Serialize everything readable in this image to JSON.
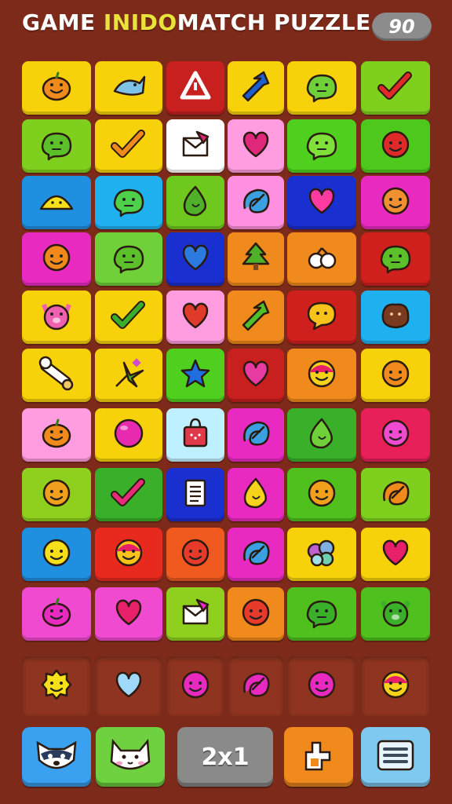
{
  "header": {
    "title_part1": "GAME ",
    "title_accent": "INIDO",
    "title_part2": "MATCH PUZZLE",
    "score": "90"
  },
  "board": {
    "rows": [
      [
        {
          "color": "#f7d20a",
          "icon": "pumpkin-icon",
          "fg": "#f08a1c"
        },
        {
          "color": "#f7d20a",
          "icon": "fish-icon",
          "fg": "#7fc3e8"
        },
        {
          "color": "#c81f1f",
          "icon": "warning-triangle-icon",
          "fg": "#ffffff"
        },
        {
          "color": "#f7d20a",
          "icon": "arrow-icon",
          "fg": "#1e5fd0"
        },
        {
          "color": "#f7d20a",
          "icon": "blob-face-icon",
          "fg": "#6fd03a"
        },
        {
          "color": "#7fd01e",
          "icon": "checkmark-icon",
          "fg": "#e02a2a"
        }
      ],
      [
        {
          "color": "#7fd01e",
          "icon": "blob-face-icon",
          "fg": "#5cc02a"
        },
        {
          "color": "#f7d20a",
          "icon": "checkmark-icon",
          "fg": "#f08a1c"
        },
        {
          "color": "#ffffff",
          "icon": "envelope-icon",
          "fg": "#e0287a"
        },
        {
          "color": "#ff9de0",
          "icon": "heart-icon",
          "fg": "#e0287a"
        },
        {
          "color": "#4fd01e",
          "icon": "blob-face-icon",
          "fg": "#7fe03a"
        },
        {
          "color": "#4fc81e",
          "icon": "round-face-icon",
          "fg": "#e02a2a"
        }
      ],
      [
        {
          "color": "#1f8fe0",
          "icon": "lemon-slice-icon",
          "fg": "#f7e01a"
        },
        {
          "color": "#1fb0f0",
          "icon": "blob-face-icon",
          "fg": "#4fd04a"
        },
        {
          "color": "#6fc81e",
          "icon": "drop-icon",
          "fg": "#4fb02a"
        },
        {
          "color": "#ff8fe0",
          "icon": "swirl-icon",
          "fg": "#3aa0e0"
        },
        {
          "color": "#1a2fd0",
          "icon": "heart-icon",
          "fg": "#ff3aa0"
        },
        {
          "color": "#e82ac0",
          "icon": "round-face-icon",
          "fg": "#f09030"
        }
      ],
      [
        {
          "color": "#e82ac0",
          "icon": "round-face-icon",
          "fg": "#f08a1c"
        },
        {
          "color": "#6fd03a",
          "icon": "blob-face-icon",
          "fg": "#5cc02a"
        },
        {
          "color": "#1a2fd0",
          "icon": "heart-icon",
          "fg": "#2a7ae0"
        },
        {
          "color": "#f08a1c",
          "icon": "tree-icon",
          "fg": "#4fb02a"
        },
        {
          "color": "#f08a1c",
          "icon": "berries-icon",
          "fg": "#ffffff"
        },
        {
          "color": "#d0201e",
          "icon": "blob-face-icon",
          "fg": "#5cc02a"
        }
      ],
      [
        {
          "color": "#f7d20a",
          "icon": "pig-face-icon",
          "fg": "#f060b0"
        },
        {
          "color": "#f7d20a",
          "icon": "checkmark-icon",
          "fg": "#3ab02a"
        },
        {
          "color": "#ff9de0",
          "icon": "heart-icon",
          "fg": "#e03a2a"
        },
        {
          "color": "#f08a1c",
          "icon": "arrow-icon",
          "fg": "#4fc02a"
        },
        {
          "color": "#d0201e",
          "icon": "speech-face-icon",
          "fg": "#f7c21a"
        },
        {
          "color": "#1fb0f0",
          "icon": "cookie-icon",
          "fg": "#7a3a20"
        }
      ],
      [
        {
          "color": "#f7d20a",
          "icon": "bone-icon",
          "fg": "#ffffff"
        },
        {
          "color": "#f7d20a",
          "icon": "star-burst-icon",
          "fg": "#4fb02a"
        },
        {
          "color": "#4fd01e",
          "icon": "star-icon",
          "fg": "#1f6fe0"
        },
        {
          "color": "#c81f1f",
          "icon": "heart-icon",
          "fg": "#e83aa0"
        },
        {
          "color": "#f08a1c",
          "icon": "smile-face-icon",
          "fg": "#f7d21a"
        },
        {
          "color": "#f7d20a",
          "icon": "round-face-icon",
          "fg": "#f08a1c"
        }
      ],
      [
        {
          "color": "#ff9de0",
          "icon": "pumpkin-icon",
          "fg": "#f08a1c"
        },
        {
          "color": "#f7d20a",
          "icon": "ball-icon",
          "fg": "#e82ab0"
        },
        {
          "color": "#bff0ff",
          "icon": "bag-icon",
          "fg": "#e03a4a"
        },
        {
          "color": "#e82ac0",
          "icon": "swirl-icon",
          "fg": "#3aa0e0"
        },
        {
          "color": "#3ab02a",
          "icon": "drop-icon",
          "fg": "#6fd03a"
        },
        {
          "color": "#e8205a",
          "icon": "round-face-icon",
          "fg": "#f04ad0"
        }
      ],
      [
        {
          "color": "#8fd01e",
          "icon": "round-face-icon",
          "fg": "#f0a01c"
        },
        {
          "color": "#3ab02a",
          "icon": "checkmark-icon",
          "fg": "#e82a7a"
        },
        {
          "color": "#1a2fd0",
          "icon": "document-icon",
          "fg": "#ffffff"
        },
        {
          "color": "#e82ac0",
          "icon": "drop-icon",
          "fg": "#f7d21a"
        },
        {
          "color": "#4fc01e",
          "icon": "round-face-icon",
          "fg": "#f0a01c"
        },
        {
          "color": "#7fd01e",
          "icon": "swirl-icon",
          "fg": "#f08a1c"
        }
      ],
      [
        {
          "color": "#1f8fe0",
          "icon": "round-face-icon",
          "fg": "#f7e01a"
        },
        {
          "color": "#e82a1e",
          "icon": "smile-face-icon",
          "fg": "#f7c21a"
        },
        {
          "color": "#f05a1e",
          "icon": "round-face-icon",
          "fg": "#e83a2a"
        },
        {
          "color": "#e82ac0",
          "icon": "swirl-icon",
          "fg": "#3aa0e0"
        },
        {
          "color": "#f7d20a",
          "icon": "cloud-icon",
          "fg": "#7fb0e0"
        },
        {
          "color": "#f7d20a",
          "icon": "heart-icon",
          "fg": "#e8206a"
        }
      ],
      [
        {
          "color": "#f04ad0",
          "icon": "pumpkin-icon",
          "fg": "#e82ac0"
        },
        {
          "color": "#f04ad0",
          "icon": "heart-icon",
          "fg": "#e8206a"
        },
        {
          "color": "#8fd01e",
          "icon": "envelope-icon",
          "fg": "#e82ac0"
        },
        {
          "color": "#f08a1c",
          "icon": "round-face-icon",
          "fg": "#e83a2a"
        },
        {
          "color": "#4fc01e",
          "icon": "blob-face-icon",
          "fg": "#3ab02a"
        },
        {
          "color": "#4fc01e",
          "icon": "pig-face-icon",
          "fg": "#3ab02a"
        }
      ]
    ]
  },
  "tray": {
    "slots": [
      {
        "icon": "spiky-face-icon",
        "fg": "#f7e01a"
      },
      {
        "icon": "heart-icon",
        "fg": "#9fd8f8"
      },
      {
        "icon": "round-face-icon",
        "fg": "#e82ac0"
      },
      {
        "icon": "swirl-icon",
        "fg": "#e82ac0"
      },
      {
        "icon": "round-face-icon",
        "fg": "#e82ac0"
      },
      {
        "icon": "smile-face-icon",
        "fg": "#f7d21a"
      }
    ]
  },
  "toolbar": {
    "buttons": [
      {
        "name": "raccoon-button",
        "icon": "raccoon-icon",
        "color": "#3aa0f0"
      },
      {
        "name": "cat-button",
        "icon": "cat-icon",
        "color": "#6fd040"
      },
      {
        "name": "combo-button",
        "label": "2x1",
        "color": "#8a8a8a"
      },
      {
        "name": "hand-button",
        "icon": "hand-icon",
        "color": "#f08a1c"
      },
      {
        "name": "menu-button",
        "icon": "menu-icon",
        "color": "#7fc8f0"
      }
    ]
  }
}
